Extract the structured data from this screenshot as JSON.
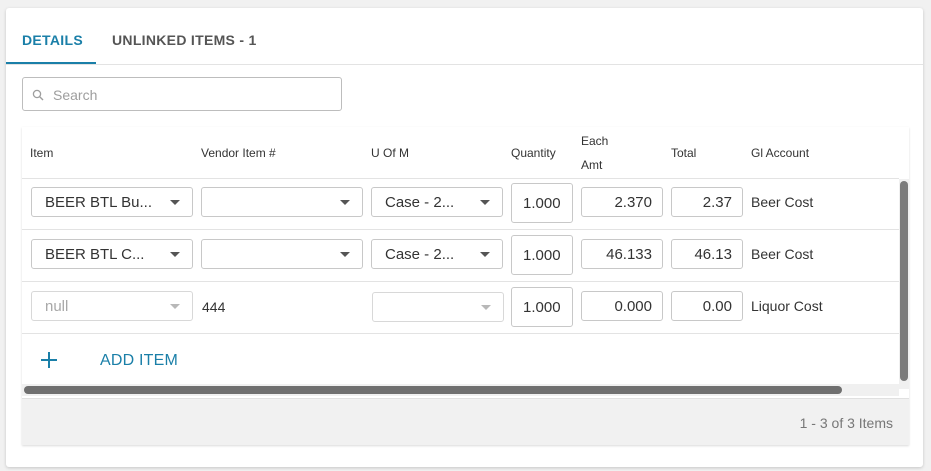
{
  "tabs": [
    {
      "label": "DETAILS",
      "active": true
    },
    {
      "label": "UNLINKED ITEMS - 1",
      "active": false
    }
  ],
  "search": {
    "placeholder": "Search",
    "value": "",
    "icon": "search-icon"
  },
  "grid": {
    "headers": {
      "item": "Item",
      "vendor_item": "Vendor Item #",
      "uofm": "U Of M",
      "quantity": "Quantity",
      "each_amt_line1": "Each",
      "each_amt_line2": "Amt",
      "total": "Total",
      "gl_account": "Gl Account"
    },
    "rows": [
      {
        "item": "BEER BTL Bu...",
        "vendor_item": "",
        "uofm": "Case - 2...",
        "quantity": "1.000",
        "each_amt": "2.370",
        "total": "2.37",
        "gl_account": "Beer Cost"
      },
      {
        "item": "BEER BTL C...",
        "vendor_item": "",
        "uofm": "Case - 2...",
        "quantity": "1.000",
        "each_amt": "46.133",
        "total": "46.13",
        "gl_account": "Beer Cost"
      },
      {
        "item": "null",
        "vendor_item": "444",
        "uofm": "",
        "quantity": "1.000",
        "each_amt": "0.000",
        "total": "0.00",
        "gl_account": "Liquor Cost"
      }
    ],
    "add_item_label": "ADD ITEM",
    "pager_text": "1 - 3 of 3 Items"
  },
  "colors": {
    "accent": "#1a7fa8",
    "scrollbar": "#7b7b7b",
    "footer_bg": "#f1f1f1"
  }
}
